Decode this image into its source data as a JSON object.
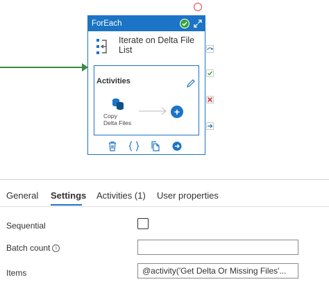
{
  "pipeline_node": {
    "type_label": "ForEach",
    "activity_name": "Iterate on Delta File List",
    "activities_label": "Activities",
    "inner_activity_label": "Copy\nDelta Files",
    "status": "success",
    "icons": {
      "status": "check-circle-icon",
      "expand": "expand-icon",
      "edit": "pencil-icon",
      "delete": "trash-icon",
      "code": "braces-icon",
      "clone": "copy-icon",
      "output": "arrow-right-circle-icon"
    }
  },
  "side_actions": [
    "skipped-icon",
    "success-check-icon",
    "failure-x-icon",
    "completion-arrow-icon"
  ],
  "tabs": [
    {
      "label": "General",
      "active": false
    },
    {
      "label": "Settings",
      "active": true
    },
    {
      "label": "Activities (1)",
      "active": false
    },
    {
      "label": "User properties",
      "active": false
    }
  ],
  "settings": {
    "sequential_label": "Sequential",
    "sequential_checked": false,
    "batch_count_label": "Batch count",
    "batch_count_value": "",
    "items_label": "Items",
    "items_value": "@activity('Get Delta Or Missing Files'..."
  },
  "colors": {
    "accent": "#1b74c5",
    "success": "#38a33a",
    "failure": "#d13438",
    "connector": "#3c8a3c"
  }
}
